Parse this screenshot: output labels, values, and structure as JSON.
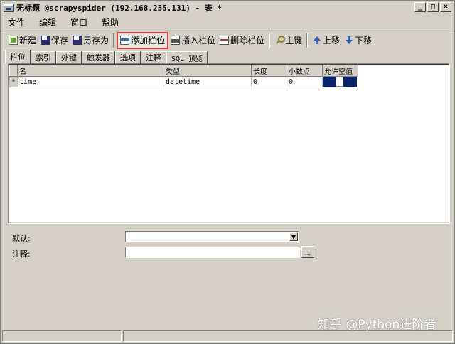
{
  "window": {
    "title": "无标题 @scrapyspider (192.168.255.131) - 表 *",
    "buttons": {
      "minimize": "_",
      "maximize": "□",
      "close": "×"
    }
  },
  "menu": [
    "文件",
    "编辑",
    "窗口",
    "帮助"
  ],
  "toolbar": {
    "new": "新建",
    "save": "保存",
    "save_as": "另存为",
    "add_field": "添加栏位",
    "insert_field": "插入栏位",
    "delete_field": "删除栏位",
    "primary_key": "主键",
    "move_up": "上移",
    "move_down": "下移"
  },
  "tabs": [
    "栏位",
    "索引",
    "外键",
    "触发器",
    "选项",
    "注释",
    "SQL 预览"
  ],
  "grid": {
    "headers": [
      "名",
      "类型",
      "长度",
      "小数点",
      "允许空值"
    ],
    "row_marker": "*",
    "rows": [
      {
        "name": "time",
        "type": "datetime",
        "length": "0",
        "decimals": "0"
      }
    ]
  },
  "fields": {
    "default_label": "默认:",
    "comment_label": "注释:",
    "ellipsis": "..."
  },
  "watermark": "知乎 @Python进阶者",
  "colors": {
    "highlight_border": "#e03c3c",
    "selection": "#0a246a"
  }
}
